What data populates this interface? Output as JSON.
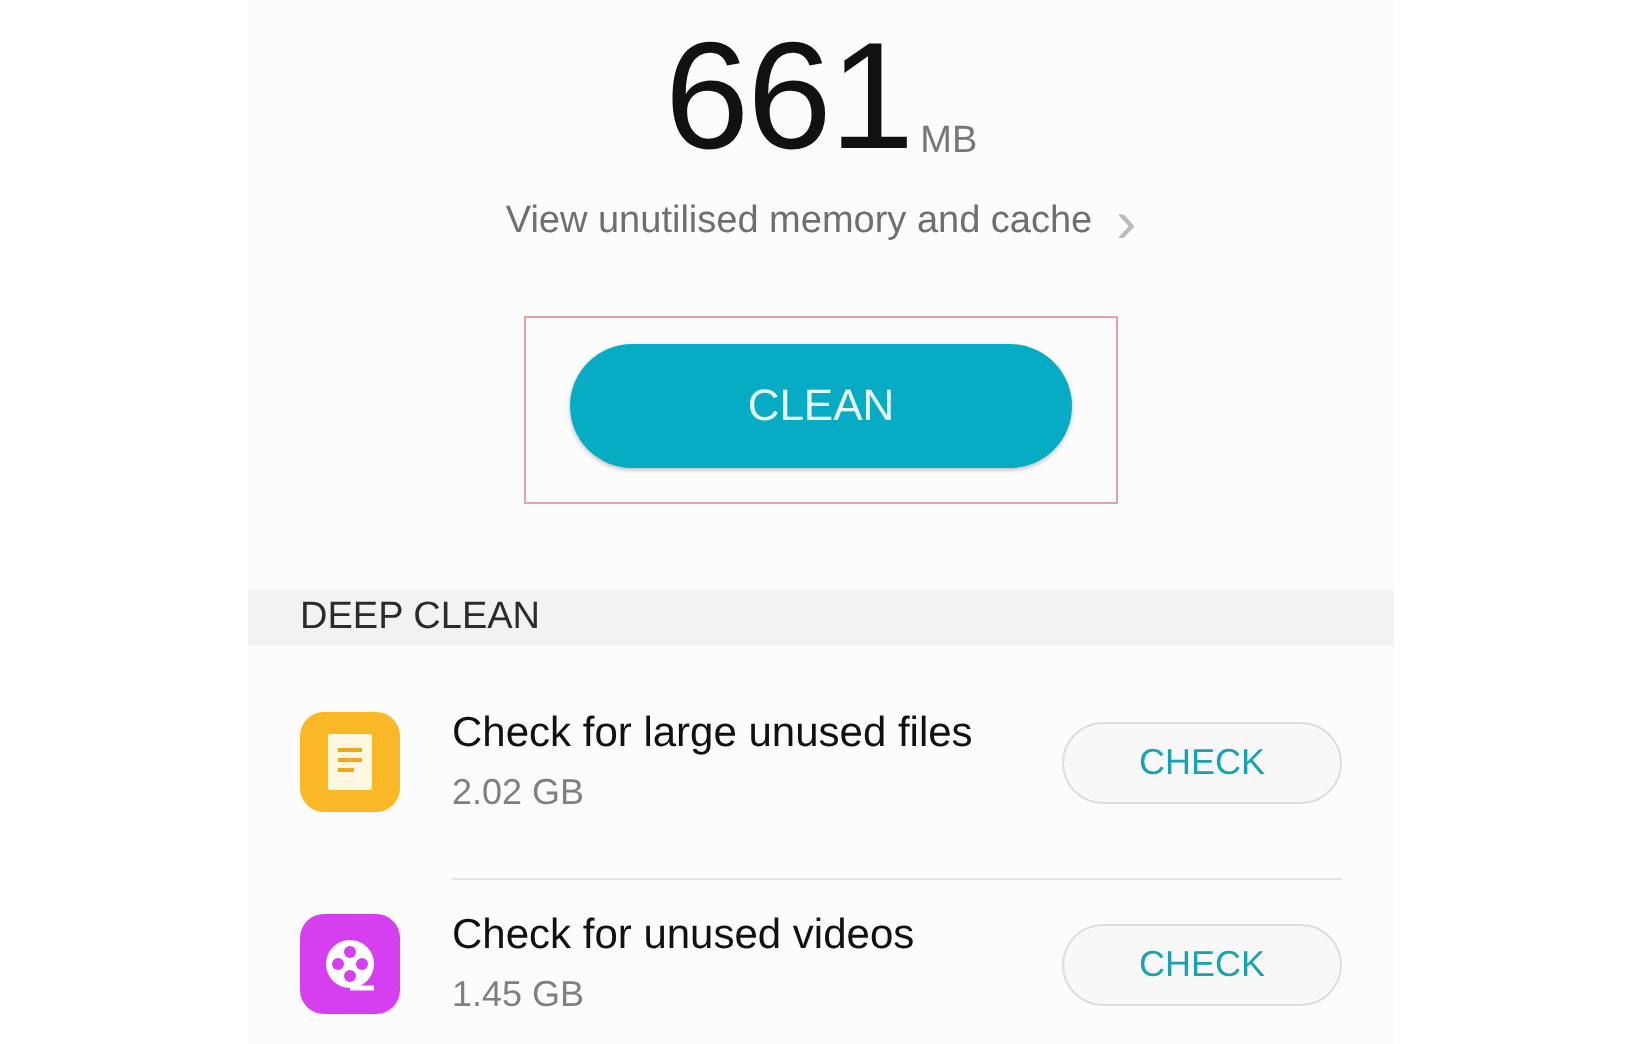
{
  "summary": {
    "amount": "661",
    "unit": "MB",
    "link": "View unutilised memory and cache",
    "link_chevron": "›"
  },
  "clean_button": {
    "label": "CLEAN",
    "highlighted": true
  },
  "deep_clean": {
    "header": "DEEP CLEAN",
    "items": [
      {
        "kind": "files",
        "color": "#fbb826",
        "title": "Check for large unused files",
        "size": "2.02 GB",
        "button": "CHECK"
      },
      {
        "kind": "videos",
        "color": "#d63ff0",
        "title": "Check for unused videos",
        "size": "1.45 GB",
        "button": "CHECK"
      }
    ]
  }
}
